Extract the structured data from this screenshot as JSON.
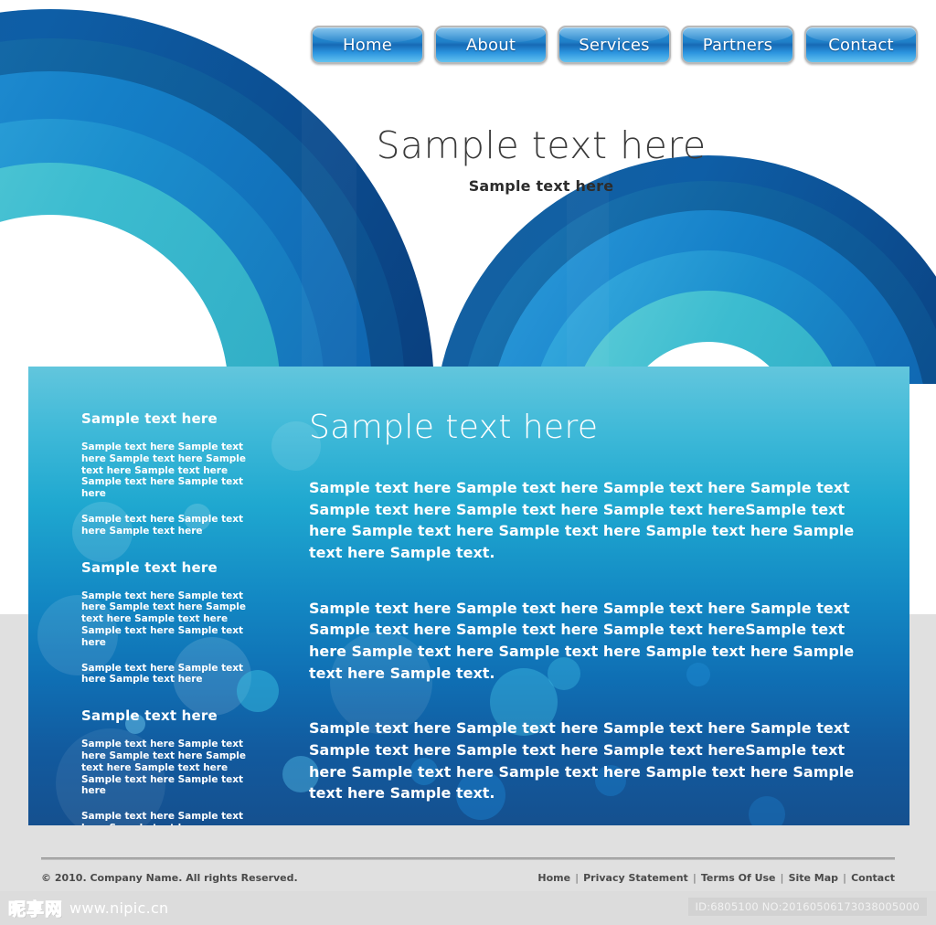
{
  "nav": {
    "items": [
      {
        "label": "Home"
      },
      {
        "label": "About"
      },
      {
        "label": "Services"
      },
      {
        "label": "Partners"
      },
      {
        "label": "Contact"
      }
    ]
  },
  "hero": {
    "title": "Sample text here",
    "subtitle": "Sample text here"
  },
  "panel": {
    "sidebar": {
      "groups": [
        {
          "heading": "Sample text here",
          "paragraphs": [
            "Sample text here Sample text here Sample text here Sample text here Sample text here Sample text here Sample text here",
            "Sample text here Sample text here Sample text here"
          ]
        },
        {
          "heading": "Sample text here",
          "paragraphs": [
            "Sample text here Sample text here Sample text here Sample text here Sample text here Sample text here Sample text here",
            "Sample text here Sample text here Sample text here"
          ]
        },
        {
          "heading": "Sample text here",
          "paragraphs": [
            "Sample text here Sample text here Sample text here Sample text here Sample text here Sample text here Sample text here",
            "Sample text here Sample text here Sample text here"
          ]
        }
      ]
    },
    "main": {
      "heading": "Sample text here",
      "paragraphs": [
        "Sample text here  Sample text here Sample text here Sample text Sample text here Sample text here Sample text hereSample text here Sample text here  Sample text here  Sample text here Sample text here Sample text.",
        "Sample text here  Sample text here Sample text here Sample text Sample text here Sample text here Sample text hereSample text here Sample text here  Sample text here  Sample text here Sample text here Sample text.",
        "Sample text here  Sample text here Sample text here Sample text Sample text here Sample text here Sample text hereSample text here Sample text here  Sample text here  Sample text here Sample text here Sample text."
      ]
    }
  },
  "footer": {
    "copyright": "© 2010. Company Name. All rights Reserved.",
    "links": [
      "Home",
      "Privacy Statement",
      "Terms Of Use",
      "Site Map",
      "Contact"
    ],
    "separator": "|"
  },
  "watermark": {
    "logo_cn": "昵享网",
    "logo_url": "www.nipic.cn",
    "id_text": "ID:6805100 NO:20160506173038005000"
  },
  "colors": {
    "page_background": "#e0e0e0",
    "nav_blue": "#1f7fc8",
    "panel_top": "#62c6dd",
    "panel_bottom": "#15508f",
    "arc_navy": "#0d4f96",
    "arc_blue": "#1277c0",
    "arc_teal": "#3fbfd0",
    "text_dark": "#3b3b3b"
  }
}
